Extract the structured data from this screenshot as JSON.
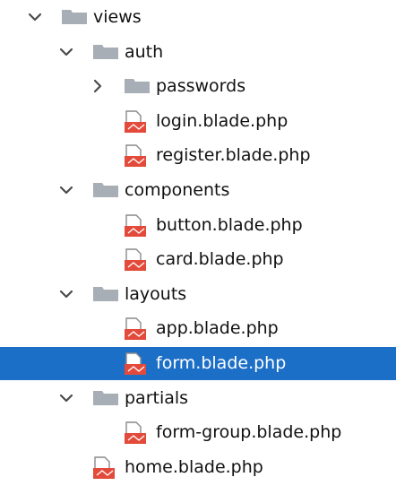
{
  "tree": [
    {
      "label": "views",
      "type": "folder",
      "expanded": true,
      "depth": 0,
      "icon": "folder-icon"
    },
    {
      "label": "auth",
      "type": "folder",
      "expanded": true,
      "depth": 1,
      "icon": "folder-icon"
    },
    {
      "label": "passwords",
      "type": "folder",
      "expanded": false,
      "depth": 2,
      "icon": "folder-icon"
    },
    {
      "label": "login.blade.php",
      "type": "file",
      "depth": 2,
      "icon": "blade-file-icon"
    },
    {
      "label": "register.blade.php",
      "type": "file",
      "depth": 2,
      "icon": "blade-file-icon"
    },
    {
      "label": "components",
      "type": "folder",
      "expanded": true,
      "depth": 1,
      "icon": "folder-icon"
    },
    {
      "label": "button.blade.php",
      "type": "file",
      "depth": 2,
      "icon": "blade-file-icon"
    },
    {
      "label": "card.blade.php",
      "type": "file",
      "depth": 2,
      "icon": "blade-file-icon"
    },
    {
      "label": "layouts",
      "type": "folder",
      "expanded": true,
      "depth": 1,
      "icon": "folder-icon"
    },
    {
      "label": "app.blade.php",
      "type": "file",
      "depth": 2,
      "icon": "blade-file-icon"
    },
    {
      "label": "form.blade.php",
      "type": "file",
      "depth": 2,
      "icon": "blade-file-icon",
      "selected": true
    },
    {
      "label": "partials",
      "type": "folder",
      "expanded": true,
      "depth": 1,
      "icon": "folder-icon"
    },
    {
      "label": "form-group.blade.php",
      "type": "file",
      "depth": 2,
      "icon": "blade-file-icon"
    },
    {
      "label": "home.blade.php",
      "type": "file",
      "depth": 1,
      "icon": "blade-file-icon"
    }
  ],
  "colors": {
    "selection": "#1c6fc6",
    "folder": "#a8aeb6",
    "blade_red": "#e24b3b",
    "arrow": "#4a4a4a"
  }
}
